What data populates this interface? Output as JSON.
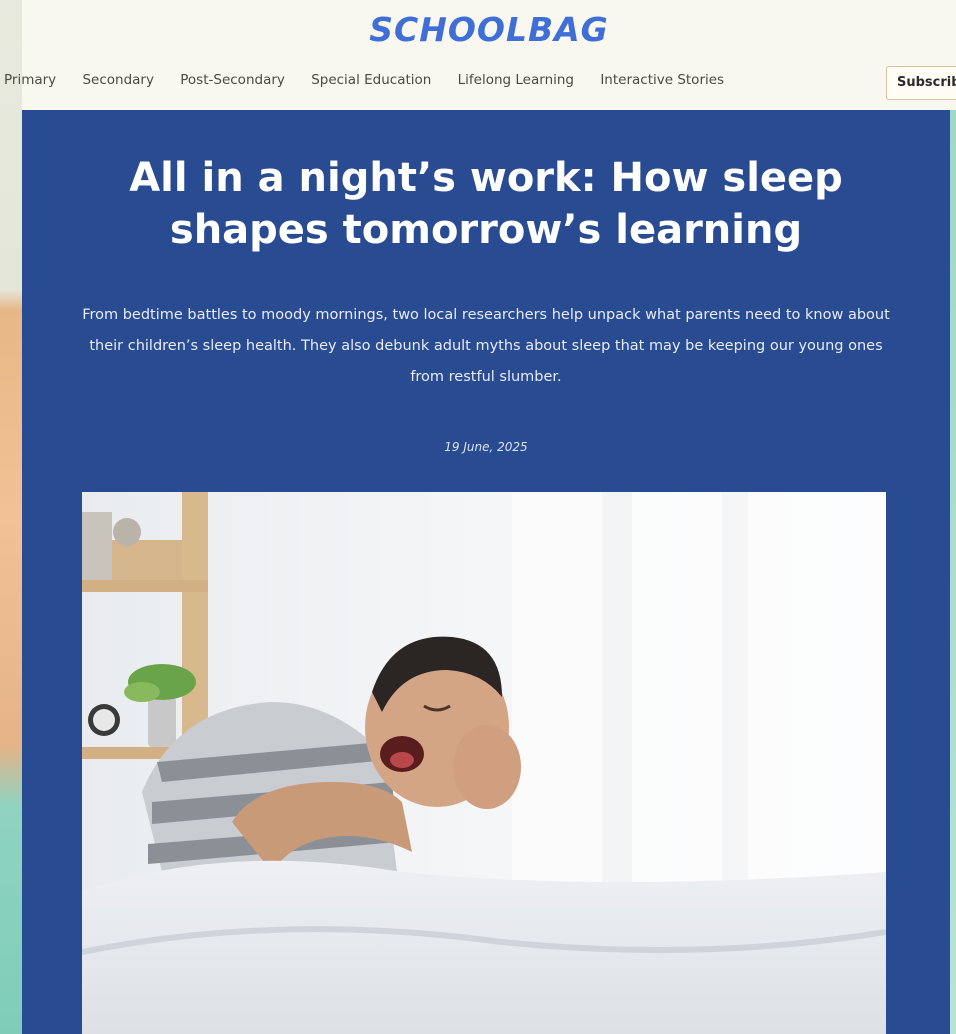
{
  "site": {
    "logo": "SCHOOLBAG"
  },
  "nav": {
    "items": [
      "Primary",
      "Secondary",
      "Post-Secondary",
      "Special Education",
      "Lifelong Learning",
      "Interactive Stories"
    ],
    "subscribe_label": "Subscribe"
  },
  "article": {
    "title": "All in a night’s work: How sleep shapes tomorrow’s learning",
    "subtitle": "From bedtime battles to moody mornings, two local researchers help unpack what parents need to know about their children’s sleep health. They also debunk adult myths about sleep that may be keeping our young ones from restful slumber.",
    "date": "19 June, 2025"
  },
  "colors": {
    "hero_background": "#294b91",
    "logo": "#3f6fd6",
    "header_background": "#f8f7f0"
  }
}
